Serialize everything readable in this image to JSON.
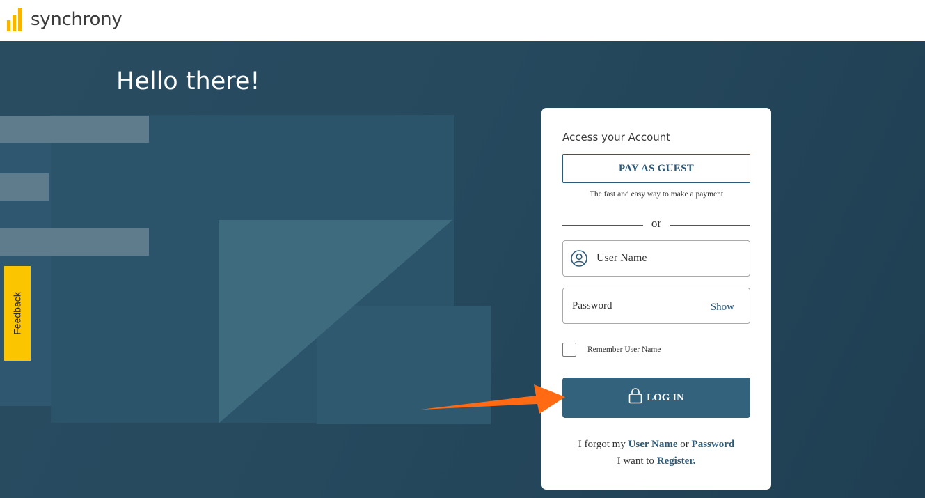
{
  "brand": {
    "name": "synchrony",
    "accent": "#f7b500",
    "icon": "synchrony-bars-logo"
  },
  "hero": {
    "greeting": "Hello there!"
  },
  "feedback": {
    "label": "Feedback"
  },
  "login_card": {
    "title": "Access your Account",
    "guest_button": "PAY AS GUEST",
    "guest_subtitle": "The fast and easy way to make a payment",
    "divider": "or",
    "username_placeholder": "User Name",
    "password_placeholder": "Password",
    "show_label": "Show",
    "remember_label": "Remember User Name",
    "remember_checked": false,
    "login_button": "LOG IN",
    "forgot_prefix": "I forgot my",
    "forgot_username": "User Name",
    "forgot_or": "or",
    "forgot_password": "Password",
    "register_prefix": "I want to",
    "register_link": "Register."
  },
  "colors": {
    "primary": "#33627d",
    "link": "#2d5a78",
    "feedback_tab": "#fbc600",
    "arrow": "#ff6a13"
  }
}
